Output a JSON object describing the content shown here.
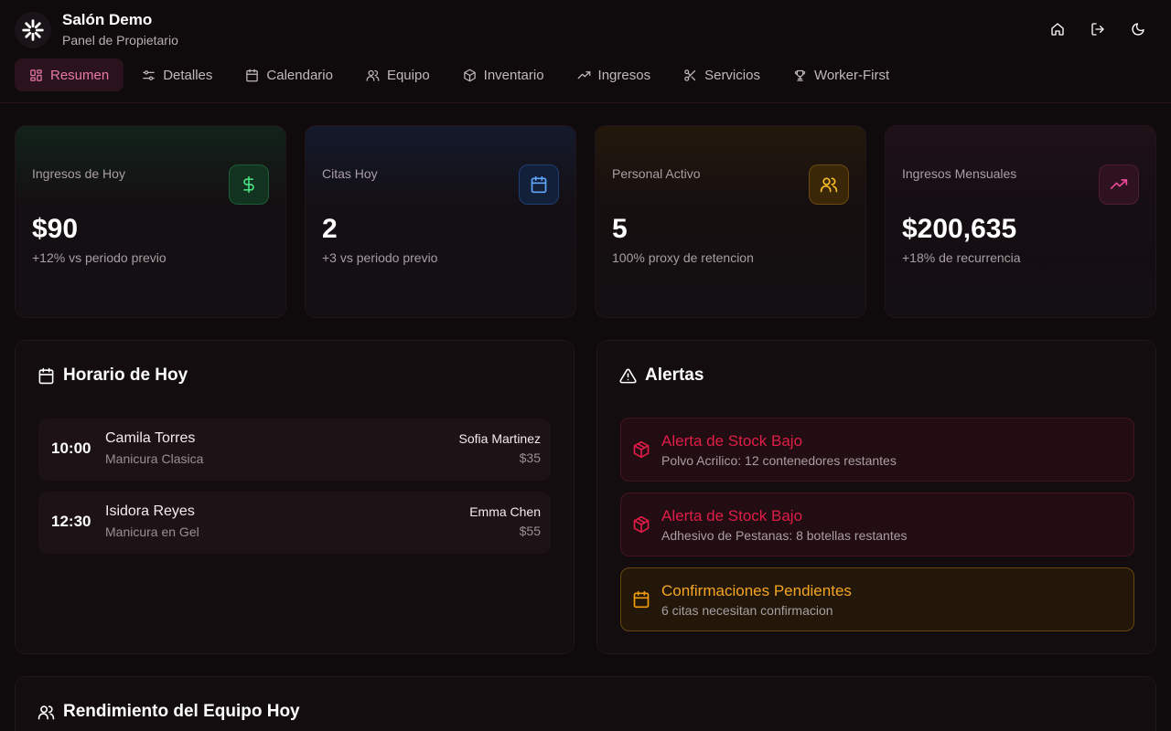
{
  "brand": {
    "title": "Salón Demo",
    "subtitle": "Panel de Propietario"
  },
  "header_actions": [
    {
      "icon": "home-icon"
    },
    {
      "icon": "logout-icon"
    },
    {
      "icon": "moon-icon"
    }
  ],
  "tabs": [
    {
      "label": "Resumen",
      "icon": "grid-icon",
      "active": true
    },
    {
      "label": "Detalles",
      "icon": "sliders-icon"
    },
    {
      "label": "Calendario",
      "icon": "calendar-icon"
    },
    {
      "label": "Equipo",
      "icon": "users-icon"
    },
    {
      "label": "Inventario",
      "icon": "box-icon"
    },
    {
      "label": "Ingresos",
      "icon": "trending-up-icon"
    },
    {
      "label": "Servicios",
      "icon": "scissors-icon"
    },
    {
      "label": "Worker-First",
      "icon": "trophy-icon"
    }
  ],
  "stats": [
    {
      "label": "Ingresos de Hoy",
      "value": "$90",
      "sub": "+12% vs periodo previo",
      "icon": "dollar-icon",
      "color": "#4ade80"
    },
    {
      "label": "Citas Hoy",
      "value": "2",
      "sub": "+3 vs periodo previo",
      "icon": "calendar-icon",
      "color": "#60a5fa"
    },
    {
      "label": "Personal Activo",
      "value": "5",
      "sub": "100% proxy de retencion",
      "icon": "users-icon",
      "color": "#fbbf24"
    },
    {
      "label": "Ingresos Mensuales",
      "value": "$200,635",
      "sub": "+18% de recurrencia",
      "icon": "trending-up-icon",
      "color": "#ec4899"
    }
  ],
  "schedule": {
    "title": "Horario de Hoy",
    "appointments": [
      {
        "time": "10:00",
        "client": "Camila Torres",
        "service": "Manicura Clasica",
        "staff": "Sofia Martinez",
        "price": "$35"
      },
      {
        "time": "12:30",
        "client": "Isidora Reyes",
        "service": "Manicura en Gel",
        "staff": "Emma Chen",
        "price": "$55"
      }
    ]
  },
  "alerts": {
    "title": "Alertas",
    "items": [
      {
        "title": "Alerta de Stock Bajo",
        "text": "Polvo Acrilico: 12 contenedores restantes",
        "kind": "red",
        "icon": "package-icon"
      },
      {
        "title": "Alerta de Stock Bajo",
        "text": "Adhesivo de Pestanas: 8 botellas restantes",
        "kind": "red",
        "icon": "package-icon"
      },
      {
        "title": "Confirmaciones Pendientes",
        "text": "6 citas necesitan confirmacion",
        "kind": "amber",
        "icon": "calendar-icon"
      }
    ]
  },
  "team": {
    "title": "Rendimiento del Equipo Hoy"
  },
  "colors": {
    "accent": "#e879a9",
    "danger": "#e11d48",
    "warning": "#f59e0b",
    "background": "#0f0a0c"
  }
}
